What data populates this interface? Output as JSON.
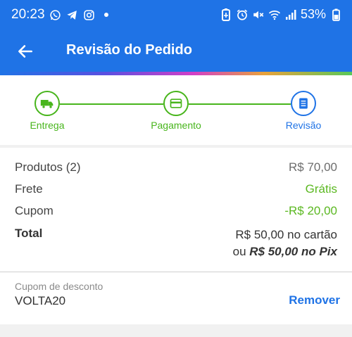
{
  "status_bar": {
    "time": "20:23",
    "battery": "53%",
    "left_icons": [
      "whatsapp-icon",
      "telegram-icon",
      "instagram-icon",
      "dot-icon"
    ],
    "right_icons": [
      "battery-saver-icon",
      "alarm-icon",
      "mute-icon",
      "wifi-icon",
      "signal-icon",
      "battery-icon"
    ]
  },
  "app_bar": {
    "title": "Revisão do Pedido",
    "back_icon": "arrow-left-icon"
  },
  "stepper": {
    "steps": [
      {
        "label": "Entrega",
        "icon": "truck-icon",
        "state": "done"
      },
      {
        "label": "Pagamento",
        "icon": "card-icon",
        "state": "done"
      },
      {
        "label": "Revisão",
        "icon": "list-icon",
        "state": "current"
      }
    ]
  },
  "summary": {
    "products_label": "Produtos (2)",
    "products_value": "R$ 70,00",
    "shipping_label": "Frete",
    "shipping_value": "Grátis",
    "coupon_label": "Cupom",
    "coupon_value": "-R$ 20,00",
    "total_label": "Total",
    "total_card": "R$ 50,00 no cartão",
    "total_pix_prefix": "ou",
    "total_pix_amount": "R$ 50,00 no Pix"
  },
  "coupon": {
    "label": "Cupom de desconto",
    "code": "VOLTA20",
    "remove_label": "Remover"
  },
  "colors": {
    "primary": "#1f73e6",
    "success": "#48b51c",
    "discount": "#5bb821"
  }
}
